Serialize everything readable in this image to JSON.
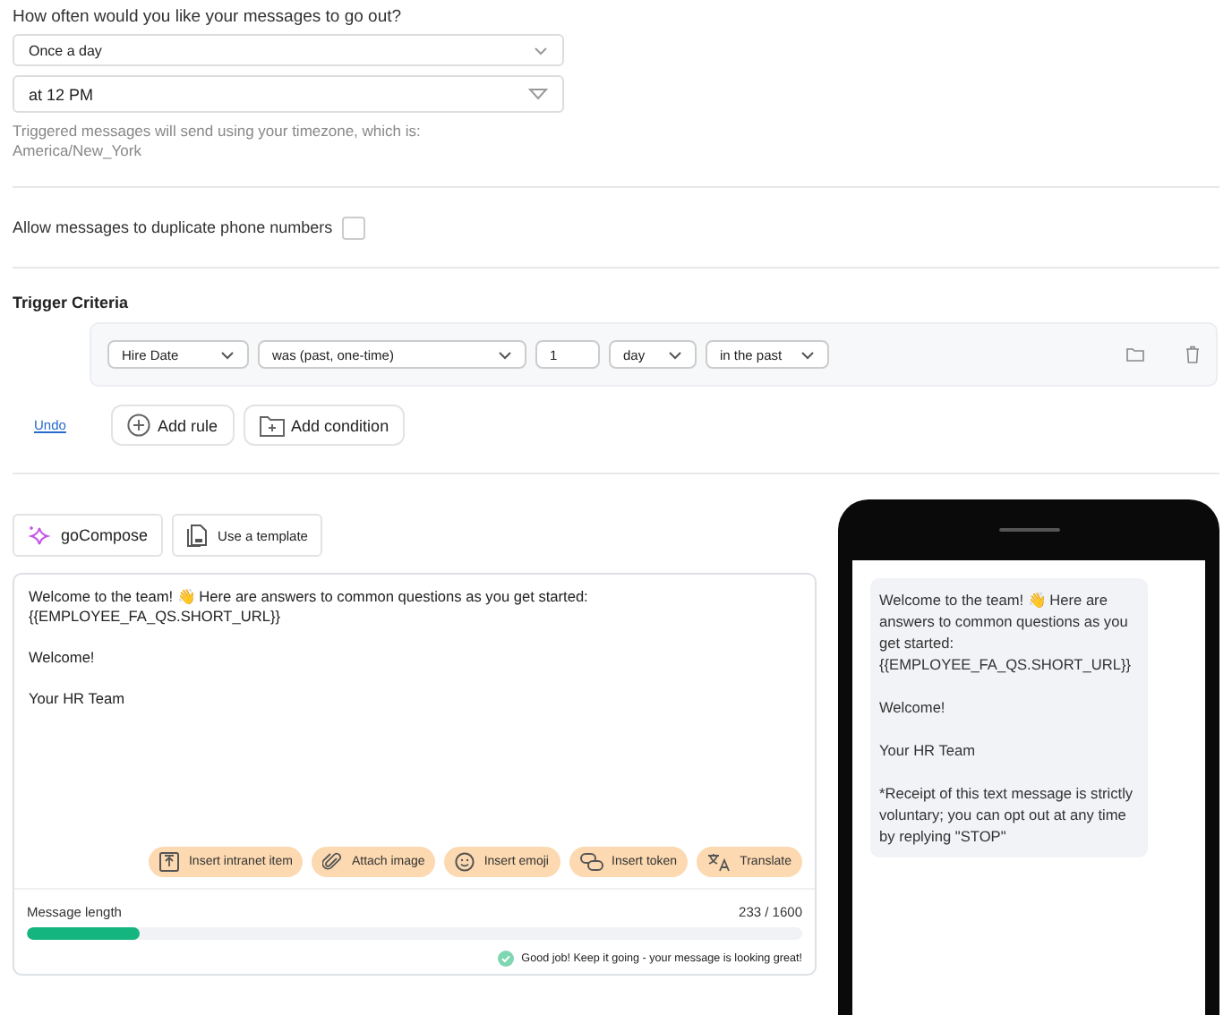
{
  "frequency": {
    "question": "How often would you like your messages to go out?",
    "selects": [
      {
        "value": "Once a day",
        "kind": "chevron"
      },
      {
        "value": "at 12 PM",
        "kind": "triangle"
      }
    ],
    "hint_lines": [
      "Triggered messages will send using your timezone, which is:",
      "America/New_York"
    ]
  },
  "duplicate_numbers": {
    "label": "Allow messages to duplicate phone numbers",
    "checked": false
  },
  "trigger_criteria": {
    "title": "Trigger Criteria",
    "rule": [
      {
        "kind": "select",
        "value": "Hire Date"
      },
      {
        "kind": "select",
        "value": "was (past, one-time)"
      },
      {
        "kind": "input",
        "value": "1"
      },
      {
        "kind": "select",
        "value": "day"
      },
      {
        "kind": "select",
        "value": "in the past"
      }
    ],
    "undo": "Undo",
    "buttons": [
      "Add rule",
      "Add condition"
    ]
  },
  "compose": {
    "tools": [
      "goCompose",
      "Use a template"
    ],
    "message": [
      [
        "Welcome to the team! 👋 Here are answers to common questions as you get started:",
        "{{EMPLOYEE_FA_QS.SHORT_URL}}"
      ],
      [
        "Welcome!"
      ],
      [
        "Your HR Team"
      ]
    ],
    "actions": [
      "Insert intranet item",
      "Attach image",
      "Insert emoji",
      "Insert token",
      "Translate"
    ],
    "length_label": "Message length",
    "count": "233 / 1600",
    "level": 0.146,
    "feedback": "Good job! Keep it going - your message is looking great!"
  },
  "preview": {
    "paragraphs": [
      "Welcome to the team! 👋 Here are answers to common questions as you get started: {{EMPLOYEE_FA_QS.SHORT_URL}}",
      "Welcome!",
      "Your HR Team",
      "*Receipt of this text message is strictly voluntary; you can opt out at any time by replying \"STOP\""
    ]
  }
}
